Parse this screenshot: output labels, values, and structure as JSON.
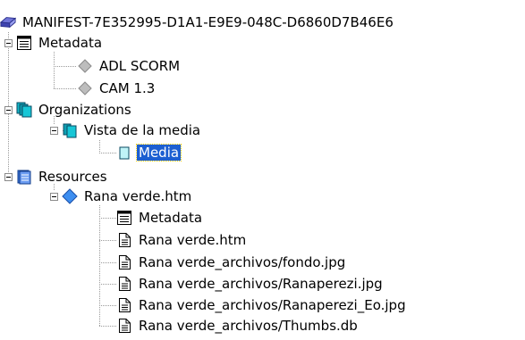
{
  "tree": {
    "root": {
      "label": "MANIFEST-7E352995-D1A1-E9E9-048C-D6860D7B46E6",
      "icon": "manifest-icon"
    },
    "metadata": {
      "label": "Metadata",
      "icon": "metadata-icon",
      "children": [
        {
          "label": "ADL SCORM",
          "icon": "diamond-icon"
        },
        {
          "label": "CAM 1.3",
          "icon": "diamond-icon"
        }
      ]
    },
    "organizations": {
      "label": "Organizations",
      "icon": "organizations-icon",
      "org": {
        "label": "Vista de la media",
        "icon": "organization-icon",
        "item": {
          "label": "Media",
          "icon": "item-icon",
          "selected": true
        }
      }
    },
    "resources": {
      "label": "Resources",
      "icon": "resources-icon",
      "resource": {
        "label": "Rana verde.htm",
        "icon": "resource-diamond-icon",
        "children": [
          {
            "label": "Metadata",
            "icon": "metadata-icon"
          },
          {
            "label": "Rana verde.htm",
            "icon": "file-icon"
          },
          {
            "label": "Rana verde_archivos/fondo.jpg",
            "icon": "file-icon"
          },
          {
            "label": "Rana verde_archivos/Ranaperezi.jpg",
            "icon": "file-icon"
          },
          {
            "label": "Rana verde_archivos/Ranaperezi_Eo.jpg",
            "icon": "file-icon"
          },
          {
            "label": "Rana verde_archivos/Thumbs.db",
            "icon": "file-icon"
          }
        ]
      }
    }
  },
  "colors": {
    "selection": "#1c5fd1",
    "connector": "#9a9a9a"
  }
}
